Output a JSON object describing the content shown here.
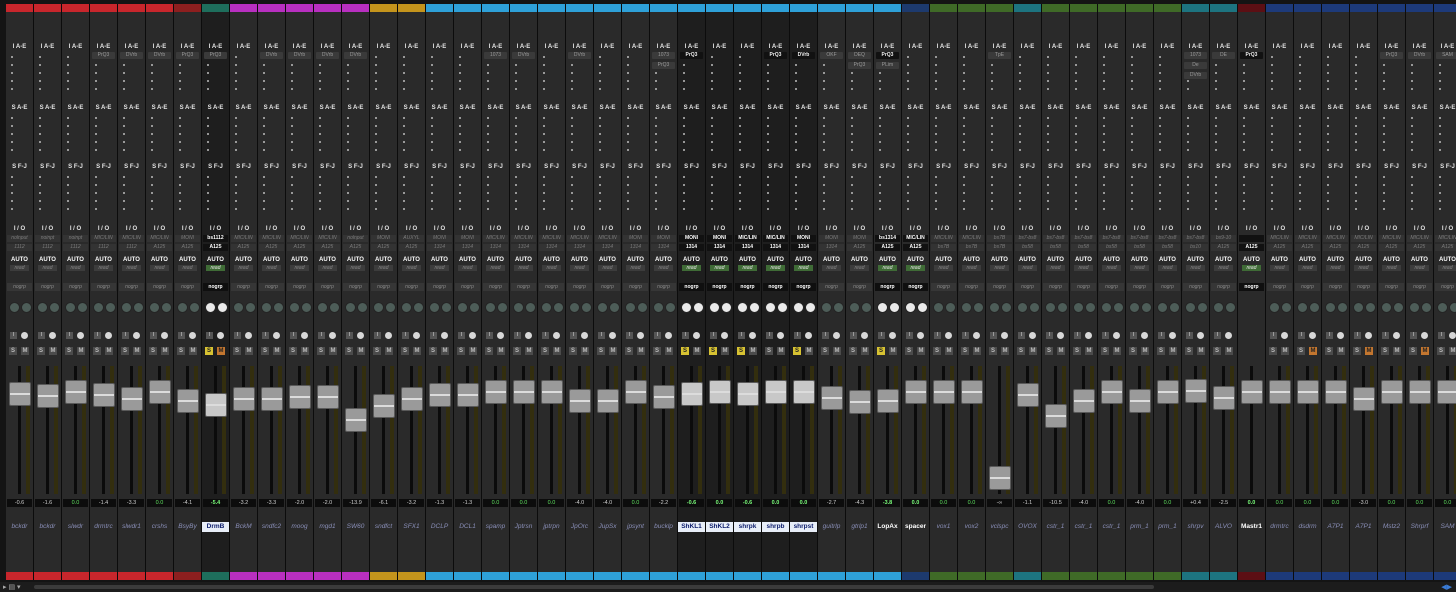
{
  "headers": {
    "inserts_ae": "I A-E",
    "sends_ae": "S A-E",
    "sends_fj": "S F-J",
    "io": "I / O"
  },
  "tracks": [
    {
      "name": "bckdr",
      "color": "#c8262c",
      "ins": [],
      "in": "nolnput",
      "out": "1112",
      "auto": "AUTO",
      "read": "read",
      "grp": "nogrp",
      "vol": "-0.6",
      "sel": false,
      "solo": false,
      "mute": false,
      "fader": 0.85,
      "ins_on": false
    },
    {
      "name": "bckdr",
      "color": "#c8262c",
      "ins": [],
      "in": "noinpt",
      "out": "1112",
      "auto": "AUTO",
      "read": "read",
      "grp": "nogrp",
      "vol": "-1.6",
      "sel": false,
      "solo": false,
      "mute": false,
      "fader": 0.83
    },
    {
      "name": "slwdr",
      "color": "#c8262c",
      "ins": [],
      "in": "noinpt",
      "out": "1112",
      "auto": "AUTO",
      "read": "read",
      "grp": "nogrp",
      "vol": "0.0",
      "sel": false,
      "solo": false,
      "mute": false,
      "fader": 0.87
    },
    {
      "name": "drmtrc",
      "color": "#c8262c",
      "ins": [
        "PrQ3"
      ],
      "in": "MIC/LIN",
      "out": "1112",
      "auto": "AUTO",
      "read": "read",
      "grp": "nogrp",
      "vol": "-1.4",
      "sel": false,
      "solo": false,
      "mute": false,
      "fader": 0.84
    },
    {
      "name": "slwdr1",
      "color": "#c8262c",
      "ins": [
        "DVrb"
      ],
      "in": "MIC/LIN",
      "out": "1112",
      "auto": "AUTO",
      "read": "read",
      "grp": "nogrp",
      "vol": "-3.3",
      "sel": false,
      "solo": false,
      "mute": false,
      "fader": 0.8
    },
    {
      "name": "crshs",
      "color": "#c8262c",
      "ins": [
        "DVrb"
      ],
      "in": "MIC/LIN",
      "out": "A125",
      "auto": "AUTO",
      "read": "read",
      "grp": "nogrp",
      "vol": "0.0",
      "sel": false,
      "solo": false,
      "mute": false,
      "fader": 0.87
    },
    {
      "name": "BsyBy",
      "color": "#8d1f1f",
      "ins": [
        "PrQ3"
      ],
      "in": "MONI",
      "out": "A125",
      "auto": "AUTO",
      "read": "read",
      "grp": "nogrp",
      "vol": "-4.1",
      "sel": false,
      "solo": false,
      "mute": false,
      "fader": 0.78
    },
    {
      "name": "DrmB",
      "color": "#1e6e5c",
      "ins": [
        "PrQ3"
      ],
      "in": "bs1112",
      "out": "A125",
      "auto": "AUTO",
      "read": "read",
      "grp": "nogrp",
      "vol": "-5.4",
      "sel": true,
      "solo": true,
      "mute": true,
      "fader": 0.75
    },
    {
      "name": "BckM",
      "color": "#b82fc0",
      "ins": [],
      "in": "MIC/LIN",
      "out": "A125",
      "auto": "AUTO",
      "read": "read",
      "grp": "nogrp",
      "vol": "-3.2",
      "sel": false,
      "solo": false,
      "mute": false,
      "fader": 0.8
    },
    {
      "name": "sndfc2",
      "color": "#b82fc0",
      "ins": [
        "DVrb"
      ],
      "in": "MIC/LIN",
      "out": "A125",
      "auto": "AUTO",
      "read": "read",
      "grp": "nogrp",
      "vol": "-3.3",
      "sel": false,
      "solo": false,
      "mute": false,
      "fader": 0.8
    },
    {
      "name": "moog",
      "color": "#b82fc0",
      "ins": [
        "DVrb"
      ],
      "in": "MIC/LIN",
      "out": "A125",
      "auto": "AUTO",
      "read": "read",
      "grp": "nogrp",
      "vol": "-2.0",
      "sel": false,
      "solo": false,
      "mute": false,
      "fader": 0.82
    },
    {
      "name": "mgd1",
      "color": "#b82fc0",
      "ins": [
        "DVrb"
      ],
      "in": "MIC/LIN",
      "out": "A125",
      "auto": "AUTO",
      "read": "read",
      "grp": "nogrp",
      "vol": "-2.0",
      "sel": false,
      "solo": false,
      "mute": false,
      "fader": 0.82
    },
    {
      "name": "SW60",
      "color": "#b82fc0",
      "ins": [
        "DVrb"
      ],
      "in": "nolnput",
      "out": "A125",
      "auto": "AUTO",
      "read": "read",
      "grp": "nogrp",
      "vol": "-13.9",
      "sel": false,
      "solo": false,
      "mute": false,
      "fader": 0.6
    },
    {
      "name": "sndfct",
      "color": "#c4941c",
      "ins": [],
      "in": "MONI",
      "out": "A125",
      "auto": "AUTO",
      "read": "read",
      "grp": "nogrp",
      "vol": "-6.1",
      "sel": false,
      "solo": false,
      "mute": false,
      "fader": 0.74
    },
    {
      "name": "SFX1",
      "color": "#c4941c",
      "ins": [],
      "in": "AUXYL",
      "out": "A125",
      "auto": "AUTO",
      "read": "read",
      "grp": "nogrp",
      "vol": "-3.2",
      "sel": false,
      "solo": false,
      "mute": false,
      "fader": 0.8
    },
    {
      "name": "DCLP",
      "color": "#2ea0d8",
      "ins": [],
      "in": "MONI",
      "out": "1314",
      "auto": "AUTO",
      "read": "read",
      "grp": "nogrp",
      "vol": "-1.3",
      "sel": false,
      "solo": false,
      "mute": false,
      "fader": 0.84
    },
    {
      "name": "DCL1",
      "color": "#2ea0d8",
      "ins": [],
      "in": "MONI",
      "out": "1314",
      "auto": "AUTO",
      "read": "read",
      "grp": "nogrp",
      "vol": "-1.3",
      "sel": false,
      "solo": false,
      "mute": false,
      "fader": 0.84
    },
    {
      "name": "spamp",
      "color": "#2ea0d8",
      "ins": [
        "1073"
      ],
      "in": "MIC/LIN",
      "out": "1314",
      "auto": "AUTO",
      "read": "read",
      "grp": "nogrp",
      "vol": "0.0",
      "sel": false,
      "solo": false,
      "mute": false,
      "fader": 0.87
    },
    {
      "name": "Jptrsn",
      "color": "#2ea0d8",
      "ins": [
        "DVrb"
      ],
      "in": "MIC/LIN",
      "out": "1314",
      "auto": "AUTO",
      "read": "read",
      "grp": "nogrp",
      "vol": "0.0",
      "sel": false,
      "solo": false,
      "mute": false,
      "fader": 0.87
    },
    {
      "name": "jptrpn",
      "color": "#2ea0d8",
      "ins": [],
      "in": "MIC/LIN",
      "out": "1314",
      "auto": "AUTO",
      "read": "read",
      "grp": "nogrp",
      "vol": "0.0",
      "sel": false,
      "solo": false,
      "mute": false,
      "fader": 0.87
    },
    {
      "name": "JpOrc",
      "color": "#2ea0d8",
      "ins": [
        "DVrb"
      ],
      "in": "MIC/LIN",
      "out": "1314",
      "auto": "AUTO",
      "read": "read",
      "grp": "nogrp",
      "vol": "-4.0",
      "sel": false,
      "solo": false,
      "mute": false,
      "fader": 0.78
    },
    {
      "name": "JupSx",
      "color": "#2ea0d8",
      "ins": [],
      "in": "MIC/LIN",
      "out": "1314",
      "auto": "AUTO",
      "read": "read",
      "grp": "nogrp",
      "vol": "-4.0",
      "sel": false,
      "solo": false,
      "mute": false,
      "fader": 0.78
    },
    {
      "name": "jpsynt",
      "color": "#2ea0d8",
      "ins": [],
      "in": "MONI",
      "out": "1314",
      "auto": "AUTO",
      "read": "read",
      "grp": "nogrp",
      "vol": "0.0",
      "sel": false,
      "solo": false,
      "mute": false,
      "fader": 0.87
    },
    {
      "name": "bucklp",
      "color": "#2ea0d8",
      "ins": [
        "1073",
        "PrQ3"
      ],
      "in": "MONI",
      "out": "1314",
      "auto": "AUTO",
      "read": "read",
      "grp": "nogrp",
      "vol": "-2.2",
      "sel": false,
      "solo": false,
      "mute": false,
      "fader": 0.82
    },
    {
      "name": "ShKL1",
      "color": "#2ea0d8",
      "ins": [
        "PrQ3"
      ],
      "in": "MONI",
      "out": "1314",
      "auto": "AUTO",
      "read": "read",
      "grp": "nogrp",
      "vol": "-0.6",
      "sel": true,
      "solo": true,
      "mute": false,
      "fader": 0.85,
      "ins_on": true
    },
    {
      "name": "ShKL2",
      "color": "#2ea0d8",
      "ins": [],
      "in": "MONI",
      "out": "1314",
      "auto": "AUTO",
      "read": "read",
      "grp": "nogrp",
      "vol": "0.0",
      "sel": true,
      "solo": true,
      "mute": false,
      "fader": 0.87
    },
    {
      "name": "shrpk",
      "color": "#2ea0d8",
      "ins": [],
      "in": "MIC/LIN",
      "out": "1314",
      "auto": "AUTO",
      "read": "read",
      "grp": "nogrp",
      "vol": "-0.6",
      "sel": true,
      "solo": true,
      "mute": false,
      "fader": 0.85
    },
    {
      "name": "shrpb",
      "color": "#2ea0d8",
      "ins": [
        "PrQ3"
      ],
      "in": "MIC/LIN",
      "out": "1314",
      "auto": "AUTO",
      "read": "read",
      "grp": "nogrp",
      "vol": "0.0",
      "sel": true,
      "solo": false,
      "mute": false,
      "fader": 0.87,
      "ins_on": true
    },
    {
      "name": "shrpst",
      "color": "#2ea0d8",
      "ins": [
        "DVrb"
      ],
      "in": "MONI",
      "out": "1314",
      "auto": "AUTO",
      "read": "read",
      "grp": "nogrp",
      "vol": "0.0",
      "sel": true,
      "solo": true,
      "mute": false,
      "fader": 0.87,
      "ins_on": true
    },
    {
      "name": "guitrlp",
      "color": "#2ea0d8",
      "ins": [
        "OKF"
      ],
      "in": "MONI",
      "out": "1314",
      "auto": "AUTO",
      "read": "read",
      "grp": "nogrp",
      "vol": "-2.7",
      "sel": false,
      "solo": false,
      "mute": false,
      "fader": 0.81
    },
    {
      "name": "gtrlp1",
      "color": "#2ea0d8",
      "ins": [
        "DEQ",
        "PrQ3"
      ],
      "in": "MONI",
      "out": "A125",
      "auto": "AUTO",
      "read": "read",
      "grp": "nogrp",
      "vol": "-4.3",
      "sel": false,
      "solo": false,
      "mute": false,
      "fader": 0.77
    },
    {
      "name": "LopAx",
      "color": "#2ea0d8",
      "ins": [
        "PrQ3",
        "PLim"
      ],
      "in": "bs1314",
      "out": "A125",
      "auto": "AUTO",
      "read": "read",
      "grp": "nogrp",
      "vol": "-3.8",
      "sel": false,
      "solo": true,
      "mute": false,
      "fader": 0.78,
      "name_white": true,
      "ins_on": true
    },
    {
      "name": "spacer",
      "color": "#1d3a6e",
      "ins": [],
      "in": "MIC/LIN",
      "out": "A125",
      "auto": "AUTO",
      "read": "read",
      "grp": "nogrp",
      "vol": "0.0",
      "sel": false,
      "solo": false,
      "mute": false,
      "fader": 0.87,
      "name_white": true
    },
    {
      "name": "vox1",
      "color": "#3f6a27",
      "ins": [],
      "in": "MIC/LIN",
      "out": "bs7B",
      "auto": "AUTO",
      "read": "read",
      "grp": "nogrp",
      "vol": "0.0",
      "sel": false,
      "solo": false,
      "mute": false,
      "fader": 0.87
    },
    {
      "name": "vox2",
      "color": "#3f6a27",
      "ins": [],
      "in": "MIC/LIN",
      "out": "bs7B",
      "auto": "AUTO",
      "read": "read",
      "grp": "nogrp",
      "vol": "0.0",
      "sel": false,
      "solo": false,
      "mute": false,
      "fader": 0.87
    },
    {
      "name": "vclspc",
      "color": "#3f6a27",
      "ins": [
        "TpE"
      ],
      "in": "bs7B",
      "out": "bs7B",
      "auto": "AUTO",
      "read": "read",
      "grp": "nogrp",
      "vol": "-∞",
      "sel": false,
      "solo": false,
      "mute": false,
      "fader": 0.06
    },
    {
      "name": "OVOX",
      "color": "#1d7480",
      "ins": [],
      "in": "bs7-bs8",
      "out": "bs58",
      "auto": "AUTO",
      "read": "read",
      "grp": "nogrp",
      "vol": "-1.1",
      "sel": false,
      "solo": false,
      "mute": false,
      "fader": 0.84
    },
    {
      "name": "cstr_1",
      "color": "#3f6a27",
      "ins": [],
      "in": "bs7-bs8",
      "out": "bs58",
      "auto": "AUTO",
      "read": "read",
      "grp": "nogrp",
      "vol": "-10.5",
      "sel": false,
      "solo": false,
      "mute": false,
      "fader": 0.64
    },
    {
      "name": "cstr_1",
      "color": "#3f6a27",
      "ins": [],
      "in": "bs7-bs8",
      "out": "bs58",
      "auto": "AUTO",
      "read": "read",
      "grp": "nogrp",
      "vol": "-4.0",
      "sel": false,
      "solo": false,
      "mute": false,
      "fader": 0.78
    },
    {
      "name": "cstr_1",
      "color": "#3f6a27",
      "ins": [],
      "in": "bs7-bs8",
      "out": "bs58",
      "auto": "AUTO",
      "read": "read",
      "grp": "nogrp",
      "vol": "0.0",
      "sel": false,
      "solo": false,
      "mute": false,
      "fader": 0.87
    },
    {
      "name": "prm_1",
      "color": "#3f6a27",
      "ins": [],
      "in": "bs7-bs8",
      "out": "bs58",
      "auto": "AUTO",
      "read": "read",
      "grp": "nogrp",
      "vol": "-4.0",
      "sel": false,
      "solo": false,
      "mute": false,
      "fader": 0.78
    },
    {
      "name": "prm_1",
      "color": "#3f6a27",
      "ins": [],
      "in": "bs7-bs8",
      "out": "bs58",
      "auto": "AUTO",
      "read": "read",
      "grp": "nogrp",
      "vol": "0.0",
      "sel": false,
      "solo": false,
      "mute": false,
      "fader": 0.87
    },
    {
      "name": "shrpv",
      "color": "#1d7480",
      "ins": [
        "1073",
        "De",
        "DVrb"
      ],
      "in": "bs7-bs8",
      "out": "bs10",
      "auto": "AUTO",
      "read": "read",
      "grp": "nogrp",
      "vol": "+0.4",
      "sel": false,
      "solo": false,
      "mute": false,
      "fader": 0.88
    },
    {
      "name": "ALVO",
      "color": "#1d7480",
      "ins": [
        "DE"
      ],
      "in": "bs9-10",
      "out": "A125",
      "auto": "AUTO",
      "read": "read",
      "grp": "nogrp",
      "vol": "-2.5",
      "sel": false,
      "solo": false,
      "mute": false,
      "fader": 0.81
    },
    {
      "name": "Mastr1",
      "color": "#5c0f14",
      "ins": [
        "PrQ3"
      ],
      "in": "",
      "out": "A125",
      "auto": "AUTO",
      "read": "read",
      "grp": "nogrp",
      "vol": "0.0",
      "sel": false,
      "solo": false,
      "mute": false,
      "fader": 0.87,
      "master": true,
      "name_white": true,
      "ins_on": true
    },
    {
      "name": "drmtrc",
      "color": "#1d3a7a",
      "ins": [],
      "in": "MIC/LIN",
      "out": "A125",
      "auto": "AUTO",
      "read": "read",
      "grp": "nogrp",
      "vol": "0.0",
      "sel": false,
      "solo": false,
      "mute": false,
      "fader": 0.87
    },
    {
      "name": "dsdrm",
      "color": "#1d3a7a",
      "ins": [],
      "in": "MIC/LIN",
      "out": "A125",
      "auto": "AUTO",
      "read": "read",
      "grp": "nogrp",
      "vol": "0.0",
      "sel": false,
      "solo": false,
      "mute": true,
      "fader": 0.87
    },
    {
      "name": "A7P1",
      "color": "#1d3a7a",
      "ins": [],
      "in": "MIC/LIN",
      "out": "A125",
      "auto": "AUTO",
      "read": "read",
      "grp": "nogrp",
      "vol": "0.0",
      "sel": false,
      "solo": false,
      "mute": false,
      "fader": 0.87
    },
    {
      "name": "A7P1",
      "color": "#1d3a7a",
      "ins": [],
      "in": "MIC/LIN",
      "out": "A125",
      "auto": "AUTO",
      "read": "read",
      "grp": "nogrp",
      "vol": "-3.0",
      "sel": false,
      "solo": false,
      "mute": true,
      "fader": 0.8
    },
    {
      "name": "Mstz2",
      "color": "#1d3a7a",
      "ins": [
        "PrQ3"
      ],
      "in": "MIC/LIN",
      "out": "A125",
      "auto": "AUTO",
      "read": "read",
      "grp": "nogrp",
      "vol": "0.0",
      "sel": false,
      "solo": false,
      "mute": false,
      "fader": 0.87
    },
    {
      "name": "Shrprf",
      "color": "#1d3a7a",
      "ins": [
        "DVrb"
      ],
      "in": "MIC/LIN",
      "out": "A125",
      "auto": "AUTO",
      "read": "read",
      "grp": "nogrp",
      "vol": "0.0",
      "sel": false,
      "solo": false,
      "mute": true,
      "fader": 0.87
    },
    {
      "name": "SAM",
      "color": "#1d3a7a",
      "ins": [
        "SAM"
      ],
      "in": "MIC/LIN",
      "out": "A125",
      "auto": "AUTO",
      "read": "read",
      "grp": "nogrp",
      "vol": "0.0",
      "sel": false,
      "solo": false,
      "mute": false,
      "fader": 0.87
    }
  ]
}
